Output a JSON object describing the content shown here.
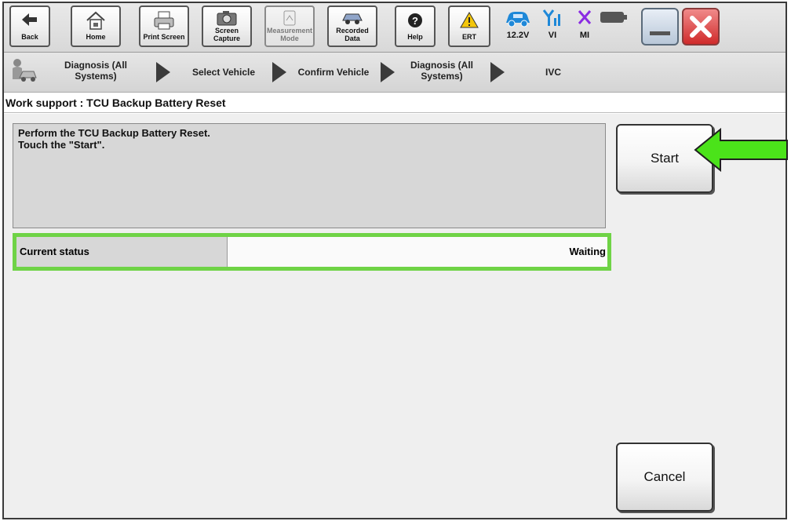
{
  "toolbar": {
    "buttons": [
      {
        "label": "Back"
      },
      {
        "label": "Home"
      },
      {
        "label": "Print Screen"
      },
      {
        "label": "Screen Capture"
      },
      {
        "label": "Measurement Mode"
      },
      {
        "label": "Recorded Data"
      },
      {
        "label": "Help"
      },
      {
        "label": "ERT"
      }
    ],
    "status": {
      "battery_voltage": "12.2V",
      "vi": "VI",
      "mi": "MI"
    }
  },
  "breadcrumb": {
    "items": [
      {
        "label": "Diagnosis (All Systems)"
      },
      {
        "label": "Select Vehicle"
      },
      {
        "label": "Confirm Vehicle"
      },
      {
        "label": "Diagnosis (All Systems)"
      },
      {
        "label": "IVC"
      }
    ]
  },
  "page": {
    "title": "Work support : TCU Backup Battery Reset"
  },
  "instructions": {
    "line1": "Perform the TCU Backup Battery Reset.",
    "line2": "Touch the \"Start\"."
  },
  "status": {
    "label": "Current status",
    "value": "Waiting"
  },
  "actions": {
    "start_label": "Start",
    "cancel_label": "Cancel"
  },
  "colors": {
    "highlight": "#6fd346",
    "arrow": "#4be31a",
    "close": "#e03b3b"
  }
}
